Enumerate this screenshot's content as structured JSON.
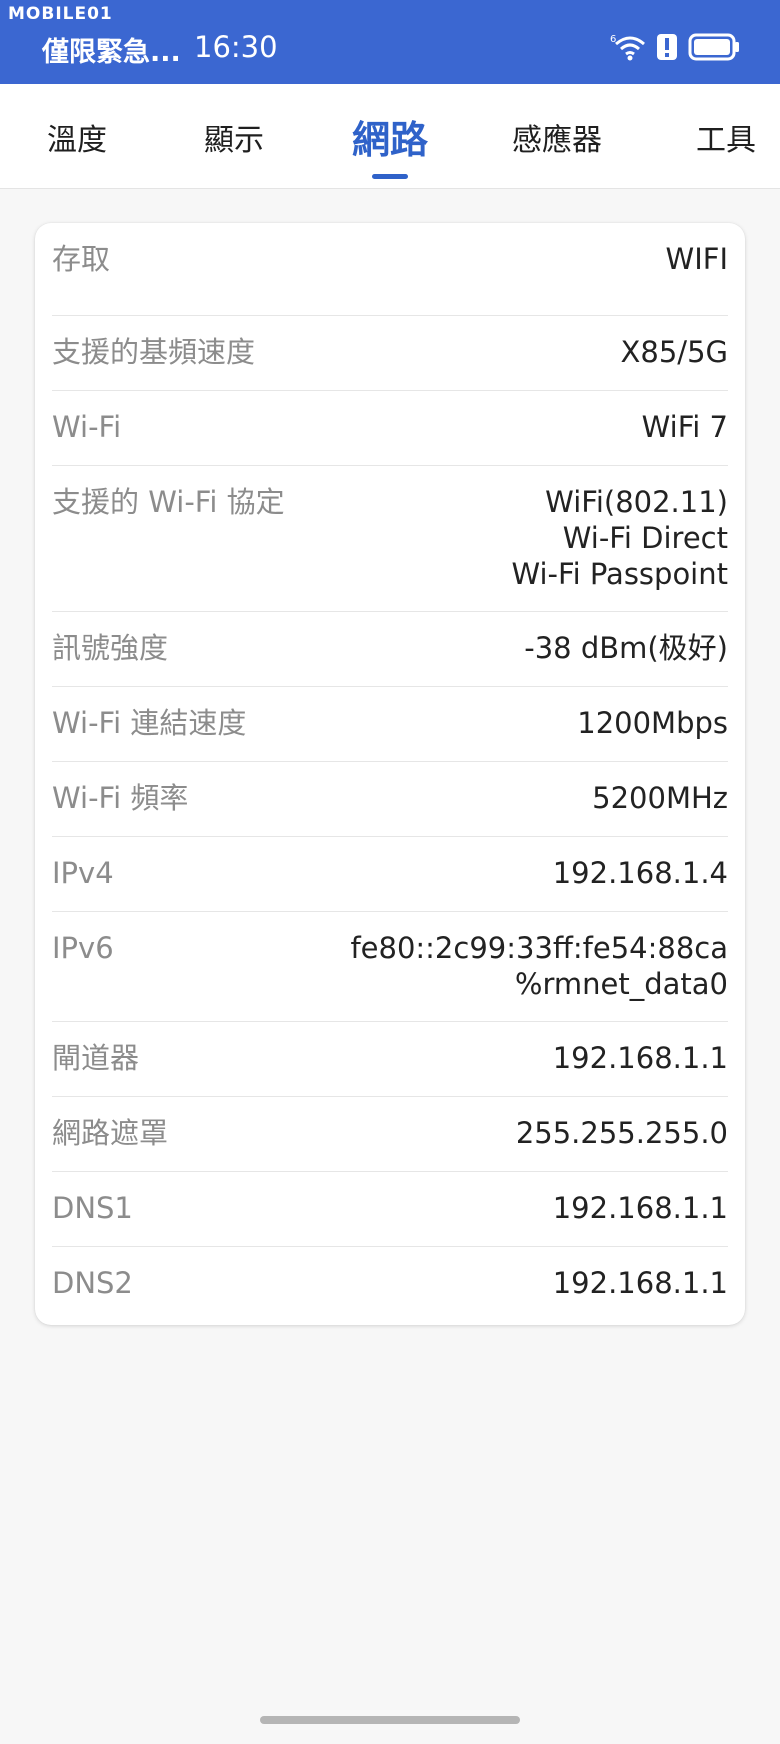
{
  "status_bar": {
    "watermark": "MOBILE01",
    "notification": "僅限緊急...",
    "time": "16:30",
    "icons": [
      "wifi-6-icon",
      "alert-icon",
      "battery-icon"
    ]
  },
  "tabs": [
    {
      "label": "溫度",
      "active": false
    },
    {
      "label": "顯示",
      "active": false
    },
    {
      "label": "網路",
      "active": true
    },
    {
      "label": "感應器",
      "active": false
    },
    {
      "label": "工具",
      "active": false
    }
  ],
  "network_info": {
    "rows": [
      {
        "label": "存取",
        "value": [
          "WIFI"
        ]
      },
      {
        "label": "支援的基頻速度",
        "value": [
          "X85/5G"
        ]
      },
      {
        "label": "Wi-Fi",
        "value": [
          "WiFi 7"
        ]
      },
      {
        "label": "支援的 Wi-Fi 協定",
        "value": [
          "WiFi(802.11)",
          "Wi-Fi Direct",
          "Wi-Fi Passpoint"
        ]
      },
      {
        "label": "訊號強度",
        "value": [
          "-38 dBm(极好)"
        ]
      },
      {
        "label": "Wi-Fi 連結速度",
        "value": [
          "1200Mbps"
        ]
      },
      {
        "label": "Wi-Fi 頻率",
        "value": [
          "5200MHz"
        ]
      },
      {
        "label": "IPv4",
        "value": [
          "192.168.1.4"
        ]
      },
      {
        "label": "IPv6",
        "value": [
          "fe80::2c99:33ff:fe54:88ca",
          "%rmnet_data0"
        ]
      },
      {
        "label": "閘道器",
        "value": [
          "192.168.1.1"
        ]
      },
      {
        "label": "網路遮罩",
        "value": [
          "255.255.255.0"
        ]
      },
      {
        "label": "DNS1",
        "value": [
          "192.168.1.1"
        ]
      },
      {
        "label": "DNS2",
        "value": [
          "192.168.1.1"
        ]
      }
    ]
  },
  "colors": {
    "status_bar": "#3b67d1",
    "accent": "#2f62c9",
    "label": "#8c8c8c",
    "value": "#222222"
  }
}
